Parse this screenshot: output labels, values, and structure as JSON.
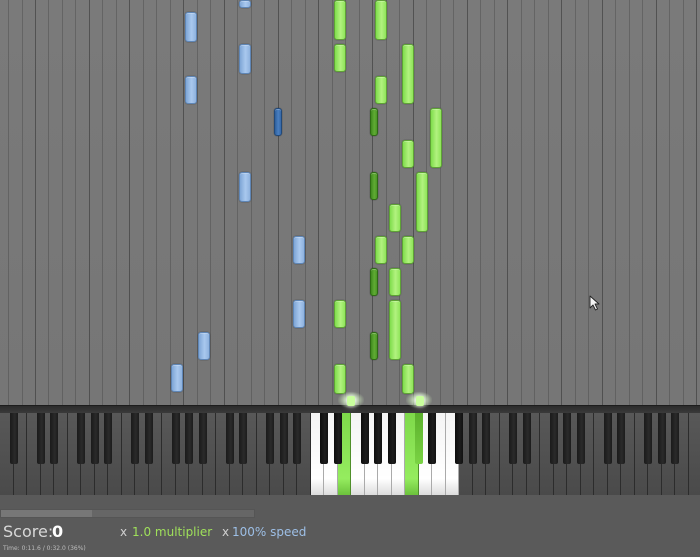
{
  "hud": {
    "score_label": "Score:",
    "score_value": "0",
    "multiplier_prefix": "x",
    "multiplier_value": "1.0 multiplier",
    "speed_prefix": "x",
    "speed_value": "100% speed",
    "time_text": "Time: 0:11.6 / 0:32.0 (36%)"
  },
  "progress": {
    "fraction": 0.36
  },
  "colors": {
    "left_hand": "#8fb4e2",
    "right_hand": "#8fe45a",
    "background": "#7a7a7a",
    "lit_key": "#ffffff"
  },
  "icons": {
    "cursor": "mouse-pointer-icon"
  }
}
